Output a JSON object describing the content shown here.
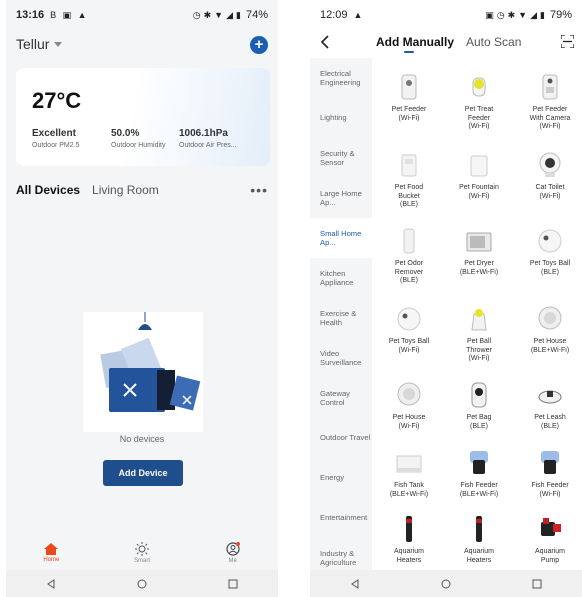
{
  "left": {
    "status": {
      "time": "13:16",
      "glyphs": "B ▣ ▲",
      "battery": "74%"
    },
    "home_name": "Tellur",
    "weather": {
      "temp": "27°C",
      "pm_value": "Excellent",
      "pm_label": "Outdoor PM2.5",
      "hum_value": "50.0%",
      "hum_label": "Outdoor Humidity",
      "air_value": "1006.1hPa",
      "air_label": "Outdoor Air Pres..."
    },
    "rooms": [
      "All Devices",
      "Living Room"
    ],
    "empty_text": "No devices",
    "add_device": "Add Device",
    "tabs": [
      "Home",
      "Smart",
      "Me"
    ],
    "accent": "#1f4e8c"
  },
  "right": {
    "status": {
      "time": "12:09",
      "battery": "79%"
    },
    "tabs": {
      "manual": "Add Manually",
      "scan": "Auto Scan"
    },
    "categories": [
      "Electrical Engineering",
      "Lighting",
      "Security & Sensor",
      "Large Home Ap...",
      "Small Home Ap...",
      "Kitchen Appliance",
      "Exercise & Health",
      "Video Surveillance",
      "Gateway Control",
      "Outdoor Travel",
      "Energy",
      "Entertainment",
      "Industry & Agriculture"
    ],
    "active_category": "Small Home Ap...",
    "devices": [
      {
        "name": "Pet Feeder\n(Wi-Fi)",
        "icon": "pet-feeder-icon"
      },
      {
        "name": "Pet Treat\nFeeder\n(Wi-Fi)",
        "icon": "pet-treat-feeder-icon"
      },
      {
        "name": "Pet Feeder\nWith Camera\n(Wi-Fi)",
        "icon": "pet-feeder-camera-icon"
      },
      {
        "name": "Pet Food\nBucket\n(BLE)",
        "icon": "pet-food-bucket-icon"
      },
      {
        "name": "Pet Fountain\n(Wi-Fi)",
        "icon": "pet-fountain-icon"
      },
      {
        "name": "Cat Toilet\n(Wi-Fi)",
        "icon": "cat-toilet-icon"
      },
      {
        "name": "Pet Odor\nRemover\n(BLE)",
        "icon": "pet-odor-remover-icon"
      },
      {
        "name": "Pet Dryer\n(BLE+Wi-Fi)",
        "icon": "pet-dryer-icon"
      },
      {
        "name": "Pet Toys Ball\n(BLE)",
        "icon": "pet-toys-ball-icon"
      },
      {
        "name": "Pet Toys Ball\n(Wi-Fi)",
        "icon": "pet-toys-ball-icon"
      },
      {
        "name": "Pet Ball\nThrower\n(Wi-Fi)",
        "icon": "pet-ball-thrower-icon"
      },
      {
        "name": "Pet House\n(BLE+Wi-Fi)",
        "icon": "pet-house-icon"
      },
      {
        "name": "Pet House\n(Wi-Fi)",
        "icon": "pet-house-icon"
      },
      {
        "name": "Pet Bag\n(BLE)",
        "icon": "pet-bag-icon"
      },
      {
        "name": "Pet Leash\n(BLE)",
        "icon": "pet-leash-icon"
      },
      {
        "name": "Fish Tank\n(BLE+Wi-Fi)",
        "icon": "fish-tank-icon"
      },
      {
        "name": "Fish Feeder\n(BLE+Wi-Fi)",
        "icon": "fish-feeder-icon"
      },
      {
        "name": "Fish Feeder\n(Wi-Fi)",
        "icon": "fish-feeder-icon"
      },
      {
        "name": "Aquarium\nHeaters",
        "icon": "aquarium-heater-icon"
      },
      {
        "name": "Aquarium\nHeaters",
        "icon": "aquarium-heater-icon"
      },
      {
        "name": "Aquarium\nPump",
        "icon": "aquarium-pump-icon"
      }
    ]
  }
}
